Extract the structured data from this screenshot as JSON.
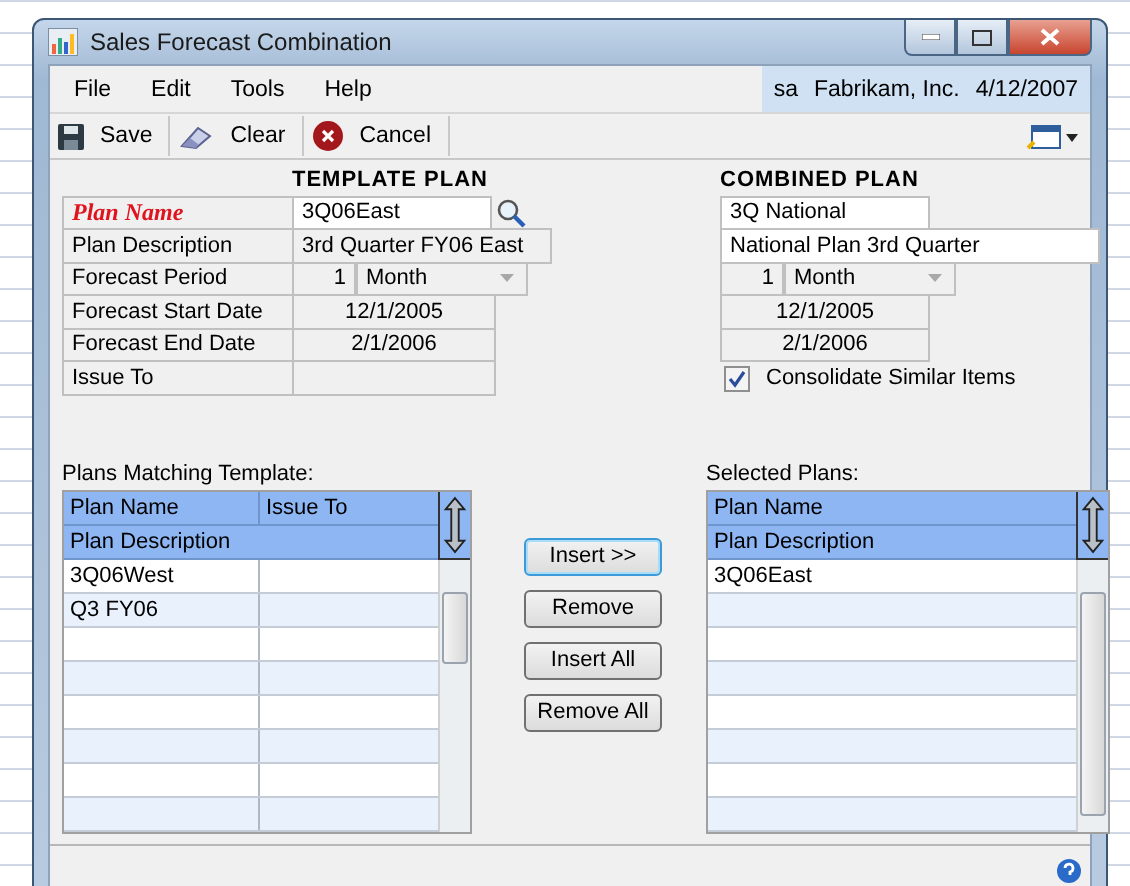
{
  "window": {
    "title": "Sales Forecast Combination"
  },
  "menu": [
    {
      "label": "File"
    },
    {
      "label": "Edit"
    },
    {
      "label": "Tools"
    },
    {
      "label": "Help"
    }
  ],
  "user_info": {
    "user": "sa",
    "company": "Fabrikam, Inc.",
    "date": "4/12/2007"
  },
  "toolbar": [
    {
      "label": "Save",
      "kind": "save"
    },
    {
      "label": "Clear",
      "kind": "clear"
    },
    {
      "label": "Cancel",
      "kind": "cancel"
    }
  ],
  "labels": [
    {
      "text": "Plan Name",
      "required": true
    },
    {
      "text": "Plan Description",
      "required": false
    },
    {
      "text": "Forecast Period",
      "required": false
    },
    {
      "text": "Forecast Start Date",
      "required": false
    },
    {
      "text": "Forecast End Date",
      "required": false
    },
    {
      "text": "Issue To",
      "required": false
    }
  ],
  "template_plan": {
    "heading": "TEMPLATE PLAN",
    "plan_name": "3Q06East",
    "plan_description": "3rd Quarter FY06 East",
    "period_count": "1",
    "period_unit": "Month",
    "start_date": "12/1/2005",
    "end_date": "2/1/2006"
  },
  "combined_plan": {
    "heading": "COMBINED PLAN",
    "plan_name": "3Q National",
    "plan_description": "National Plan 3rd Quarter",
    "period_count": "1",
    "period_unit": "Month",
    "start_date": "12/1/2005",
    "end_date": "2/1/2006",
    "consolidate": {
      "label": "Consolidate Similar Items",
      "checked": true
    }
  },
  "matching": {
    "label": "Plans Matching Template:",
    "columns": [
      "Plan Name",
      "Issue To"
    ],
    "subheader": "Plan Description",
    "rows": [
      {
        "cells": [
          "3Q06West"
        ]
      },
      {
        "cells": [
          "Q3 FY06"
        ]
      }
    ]
  },
  "actions": [
    {
      "label": "Insert >>",
      "default": true
    },
    {
      "label": "Remove",
      "default": false
    },
    {
      "label": "Insert All",
      "default": false
    },
    {
      "label": "Remove All",
      "default": false
    }
  ],
  "selected": {
    "label": "Selected Plans:",
    "columns": [
      "Plan Name"
    ],
    "subheader": "Plan Description",
    "rows": [
      {
        "cells": [
          "3Q06East"
        ]
      }
    ]
  }
}
